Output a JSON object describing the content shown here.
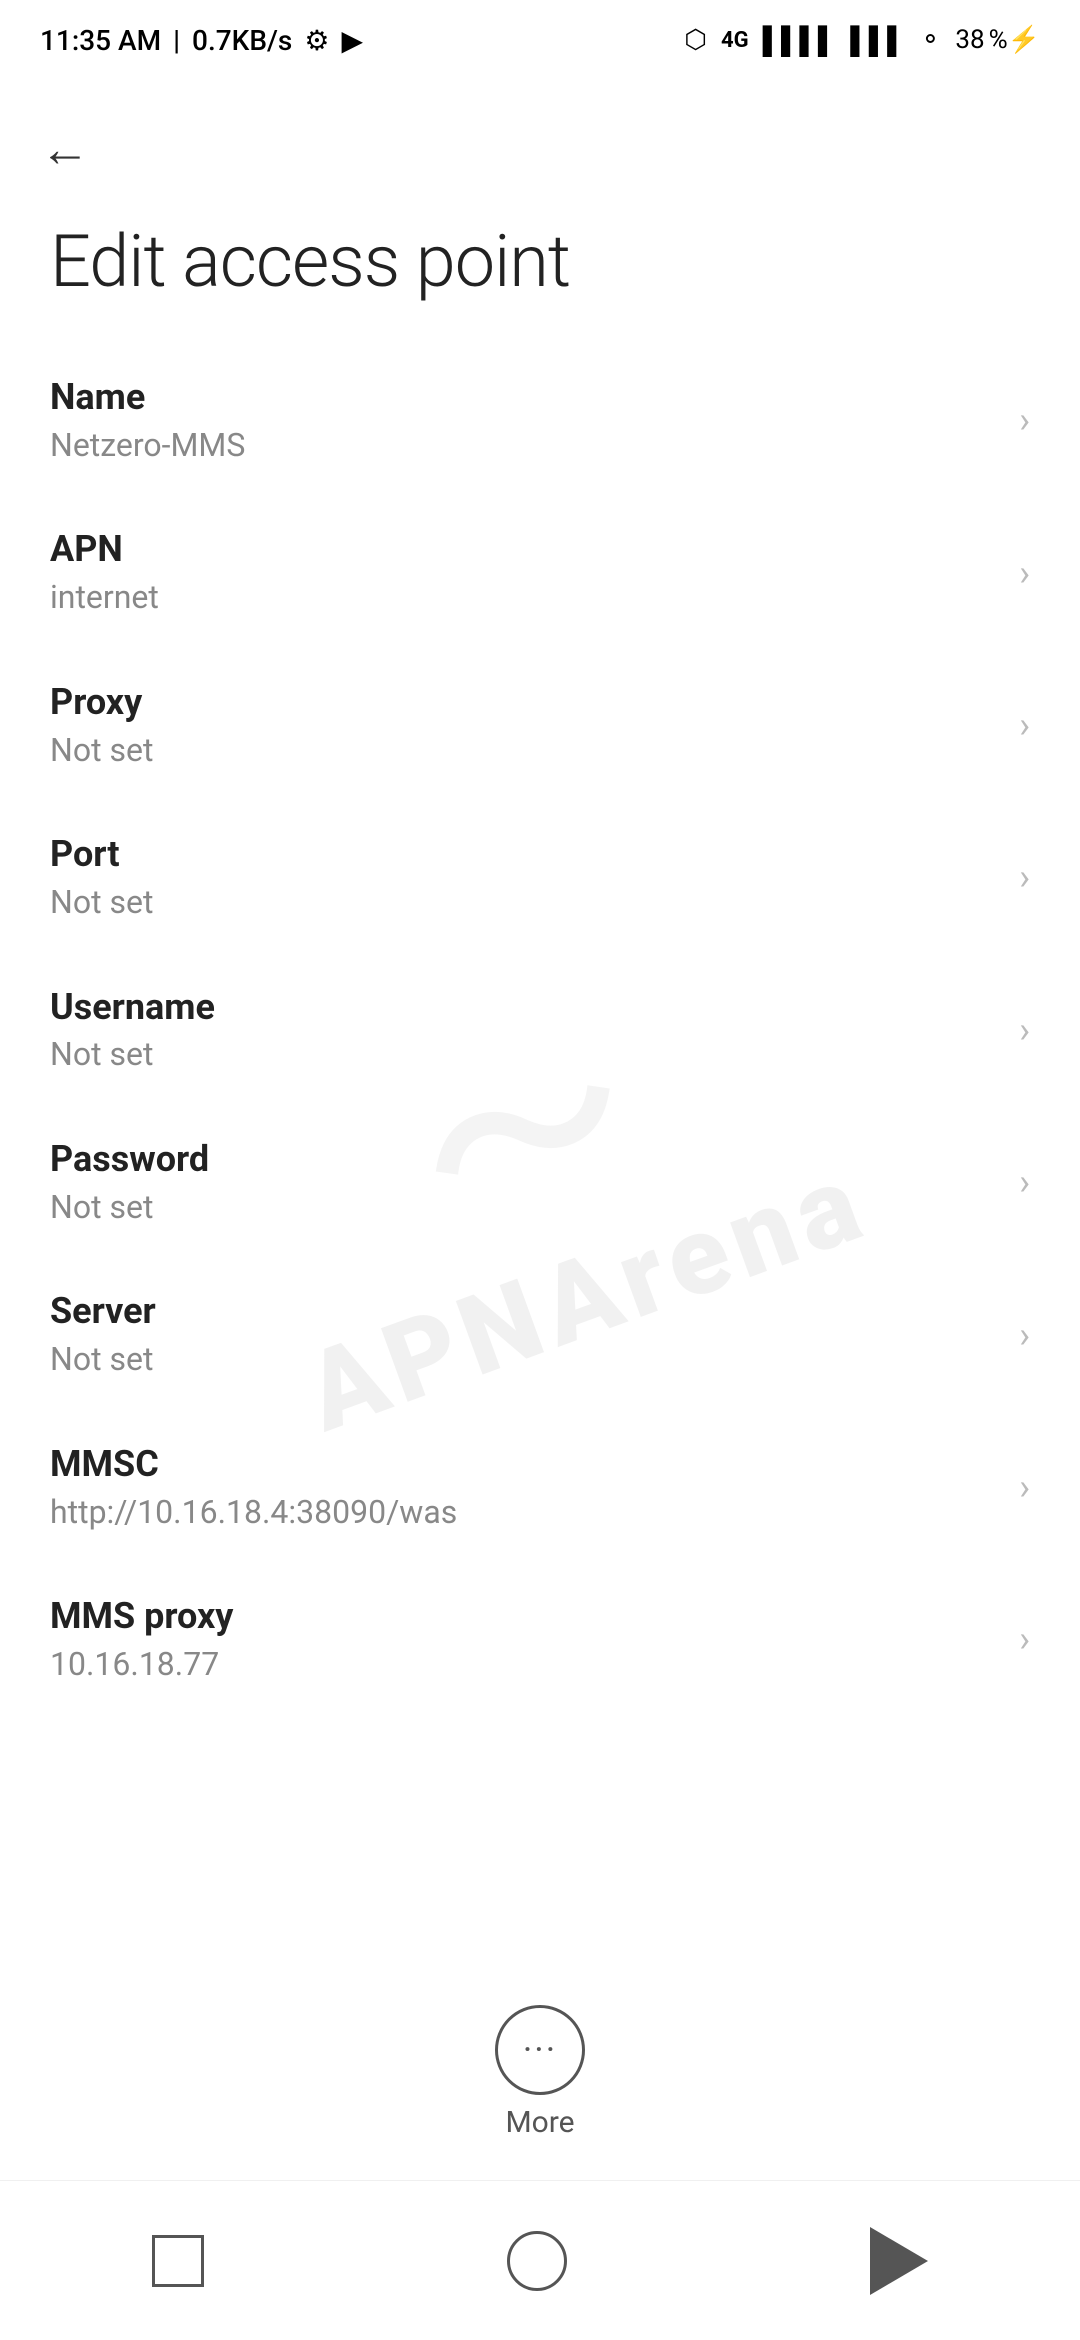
{
  "statusBar": {
    "time": "11:35 AM",
    "speed": "0.7KB/s",
    "batteryPercent": "38"
  },
  "page": {
    "title": "Edit access point",
    "backLabel": "←"
  },
  "settings": [
    {
      "id": "name",
      "label": "Name",
      "value": "Netzero-MMS"
    },
    {
      "id": "apn",
      "label": "APN",
      "value": "internet"
    },
    {
      "id": "proxy",
      "label": "Proxy",
      "value": "Not set"
    },
    {
      "id": "port",
      "label": "Port",
      "value": "Not set"
    },
    {
      "id": "username",
      "label": "Username",
      "value": "Not set"
    },
    {
      "id": "password",
      "label": "Password",
      "value": "Not set"
    },
    {
      "id": "server",
      "label": "Server",
      "value": "Not set"
    },
    {
      "id": "mmsc",
      "label": "MMSC",
      "value": "http://10.16.18.4:38090/was"
    },
    {
      "id": "mms-proxy",
      "label": "MMS proxy",
      "value": "10.16.18.77"
    }
  ],
  "more": {
    "label": "More"
  },
  "watermark": {
    "text": "APNArena"
  }
}
